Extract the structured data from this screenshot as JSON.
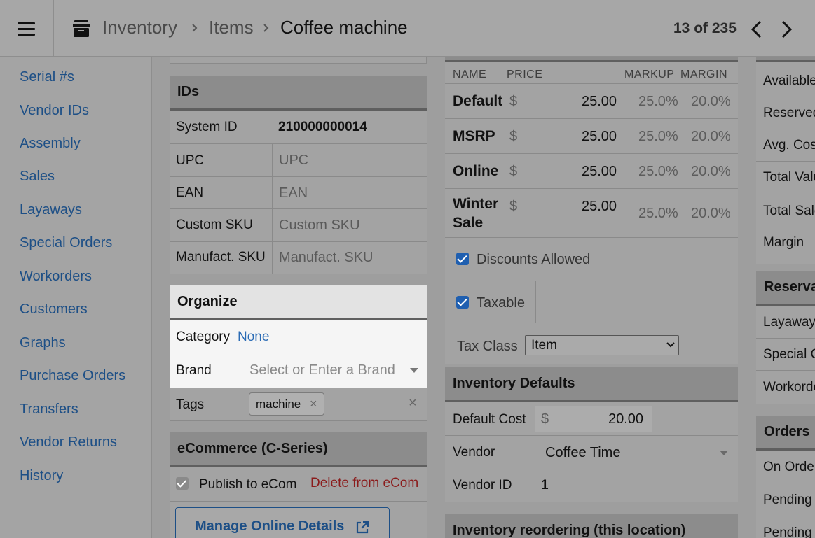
{
  "header": {
    "breadcrumb": [
      "Inventory",
      "Items",
      "Coffee machine"
    ],
    "counter": "13 of 235"
  },
  "sidebar": {
    "items": [
      "Serial #s",
      "Vendor IDs",
      "Assembly",
      "Sales",
      "Layaways",
      "Special Orders",
      "Workorders",
      "Customers",
      "Graphs",
      "Purchase Orders",
      "Transfers",
      "Vendor Returns",
      "History"
    ]
  },
  "ids": {
    "title": "IDs",
    "system_id_label": "System ID",
    "system_id_value": "210000000014",
    "upc_label": "UPC",
    "upc_placeholder": "UPC",
    "ean_label": "EAN",
    "ean_placeholder": "EAN",
    "custom_sku_label": "Custom SKU",
    "custom_sku_placeholder": "Custom SKU",
    "manufact_sku_label": "Manufact. SKU",
    "manufact_sku_placeholder": "Manufact. SKU"
  },
  "organize": {
    "title": "Organize",
    "category_label": "Category",
    "category_value": "None",
    "brand_label": "Brand",
    "brand_placeholder": "Select or Enter a Brand",
    "tags_label": "Tags",
    "tag": "machine",
    "tag_remove": "×",
    "tags_clear": "×"
  },
  "ecommerce": {
    "title": "eCommerce (C-Series)",
    "publish_label": "Publish to eCom",
    "delete_link": "Delete from eCom",
    "manage_button": "Manage Online Details"
  },
  "pricing": {
    "columns": {
      "name": "NAME",
      "price": "PRICE",
      "markup": "MARKUP",
      "margin": "MARGIN"
    },
    "currency": "$",
    "rows": [
      {
        "name": "Default",
        "price": "25.00",
        "markup": "25.0%",
        "margin": "20.0%"
      },
      {
        "name": "MSRP",
        "price": "25.00",
        "markup": "25.0%",
        "margin": "20.0%"
      },
      {
        "name": "Online",
        "price": "25.00",
        "markup": "25.0%",
        "margin": "20.0%"
      },
      {
        "name": "Winter Sale",
        "name_line1": "Winter",
        "name_line2": "Sale",
        "price": "25.00",
        "markup": "25.0%",
        "margin": "20.0%"
      }
    ],
    "discounts_label": "Discounts Allowed",
    "taxable_label": "Taxable",
    "tax_class_label": "Tax Class",
    "tax_class_value": "Item"
  },
  "inventory_defaults": {
    "title": "Inventory Defaults",
    "default_cost_label": "Default Cost",
    "currency": "$",
    "default_cost_value": "20.00",
    "vendor_label": "Vendor",
    "vendor_value": "Coffee Time",
    "vendor_id_label": "Vendor ID",
    "vendor_id_value": "1"
  },
  "reordering": {
    "title": "Inventory reordering (this location)"
  },
  "right_panel": {
    "stats": [
      "Available",
      "Reserved",
      "Avg. Cost",
      "Total Value",
      "Total Sale",
      "Margin"
    ],
    "reservations_title": "Reservations",
    "reservations": [
      "Layaways",
      "Special Orders",
      "Workorders"
    ],
    "orders_title": "Orders",
    "orders": [
      "On Order",
      "Pending",
      "Pending"
    ]
  }
}
